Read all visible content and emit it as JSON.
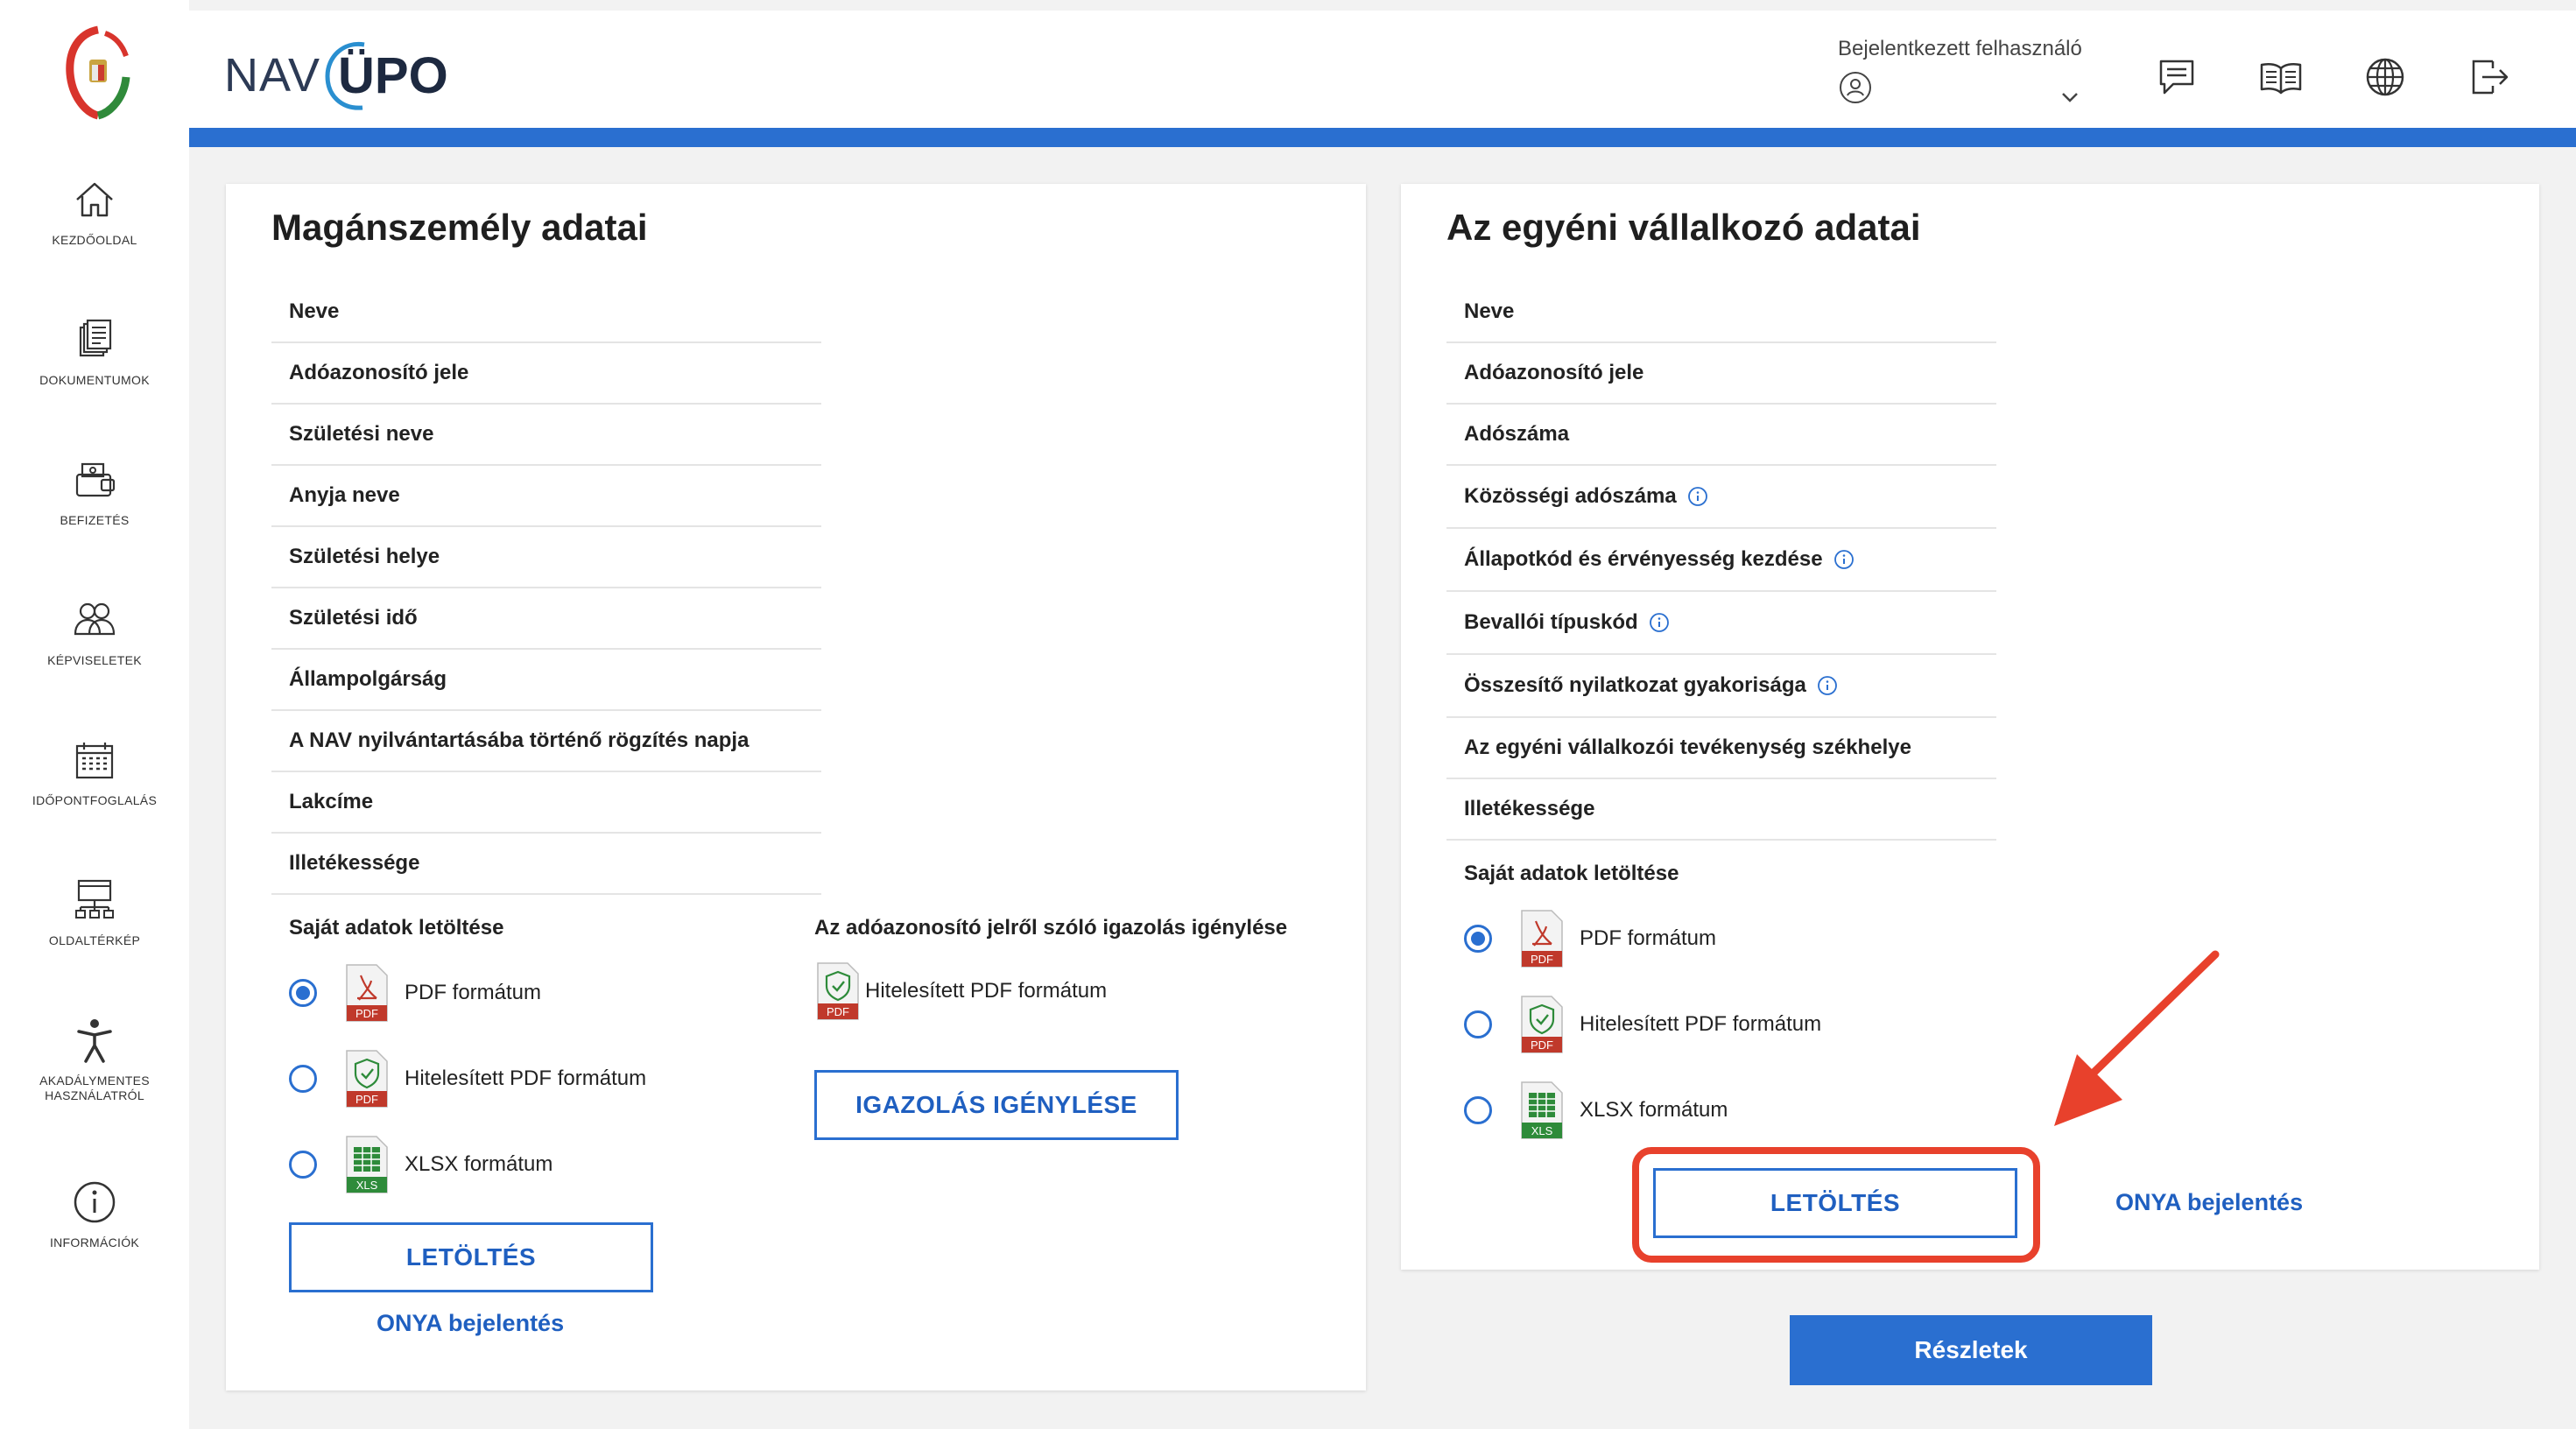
{
  "sidebar": {
    "items": [
      {
        "label": "KEZDŐOLDAL",
        "icon": "home-icon"
      },
      {
        "label": "DOKUMENTUMOK",
        "icon": "documents-icon"
      },
      {
        "label": "BEFIZETÉS",
        "icon": "payment-icon"
      },
      {
        "label": "KÉPVISELETEK",
        "icon": "people-icon"
      },
      {
        "label": "IDŐPONTFOGLALÁS",
        "icon": "calendar-icon"
      },
      {
        "label": "OLDALTÉRKÉP",
        "icon": "sitemap-icon"
      },
      {
        "label": "AKADÁLYMENTES HASZNÁLATRÓL",
        "icon": "accessibility-icon"
      },
      {
        "label": "INFORMÁCIÓK",
        "icon": "info-icon"
      }
    ]
  },
  "header": {
    "brand_nav": "NAV",
    "brand_upo": "ÜPO",
    "user_label": "Bejelentkezett felhasználó",
    "icons": [
      "messages-icon",
      "book-icon",
      "language-globe-icon",
      "logout-icon"
    ]
  },
  "left_card": {
    "title": "Magánszemély adatai",
    "fields": [
      "Neve",
      "Adóazonosító jele",
      "Születési neve",
      "Anyja neve",
      "Születési helye",
      "Születési idő",
      "Állampolgárság",
      "A NAV nyilvántartásába történő rögzítés napja",
      "Lakcíme",
      "Illetékessége"
    ],
    "download_label": "Saját adatok letöltése",
    "formats": [
      {
        "label": "PDF formátum",
        "badge": "PDF",
        "checked": true
      },
      {
        "label": "Hitelesített PDF formátum",
        "badge": "PDF",
        "checked": false
      },
      {
        "label": "XLSX formátum",
        "badge": "XLS",
        "checked": false
      }
    ],
    "download_button": "LETÖLTÉS",
    "onya_link": "ONYA bejelentés",
    "cert_label": "Az adóazonosító jelről szóló igazolás igénylése",
    "cert_format": {
      "label": "Hitelesített PDF formátum",
      "badge": "PDF"
    },
    "cert_button": "IGAZOLÁS IGÉNYLÉSE"
  },
  "right_card": {
    "title": "Az egyéni vállalkozó adatai",
    "fields": [
      {
        "label": "Neve",
        "info": false
      },
      {
        "label": "Adóazonosító jele",
        "info": false
      },
      {
        "label": "Adószáma",
        "info": false
      },
      {
        "label": "Közösségi adószáma",
        "info": true
      },
      {
        "label": "Állapotkód és érvényesség kezdése",
        "info": true
      },
      {
        "label": "Bevallói típuskód",
        "info": true
      },
      {
        "label": "Összesítő nyilatkozat gyakorisága",
        "info": true
      },
      {
        "label": "Az egyéni vállalkozói tevékenység székhelye",
        "info": false
      },
      {
        "label": "Illetékessége",
        "info": false
      }
    ],
    "download_label": "Saját adatok letöltése",
    "formats": [
      {
        "label": "PDF formátum",
        "badge": "PDF",
        "checked": true
      },
      {
        "label": "Hitelesített PDF formátum",
        "badge": "PDF",
        "checked": false
      },
      {
        "label": "XLSX formátum",
        "badge": "XLS",
        "checked": false
      }
    ],
    "download_button": "LETÖLTÉS",
    "onya_link": "ONYA bejelentés"
  },
  "details_button": "Részletek",
  "colors": {
    "accent": "#2a6fd0",
    "link": "#1f5fc0",
    "highlight": "#e8412c",
    "pdf_red": "#c0392b",
    "xls_green": "#2e8b3a"
  }
}
